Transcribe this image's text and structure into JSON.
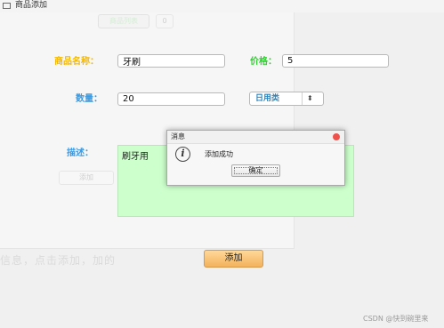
{
  "window": {
    "title": "商品添加"
  },
  "ghost": {
    "tab_label": "商品列表",
    "tab_number": "0",
    "button_label": "添加",
    "hint_text": "信息，点击添加，加的"
  },
  "form": {
    "name_label": "商品名称：",
    "name_value": "牙刷",
    "price_label": "价格：",
    "price_value": "5",
    "qty_label": "数量：",
    "qty_value": "20",
    "category_selected": "日用类",
    "desc_label": "描述：",
    "desc_value": "刷牙用",
    "submit_label": "添加"
  },
  "dialog": {
    "title": "消息",
    "message": "添加成功",
    "ok_label": "确定",
    "icon": "info-icon"
  },
  "watermark": "CSDN @快到碗里来",
  "colors": {
    "orange_label": "#f5b800",
    "blue_label": "#3b9ae0",
    "green_label": "#2fd12f",
    "desc_bg": "#ccffcc",
    "button_orange": "#f3b35c"
  }
}
